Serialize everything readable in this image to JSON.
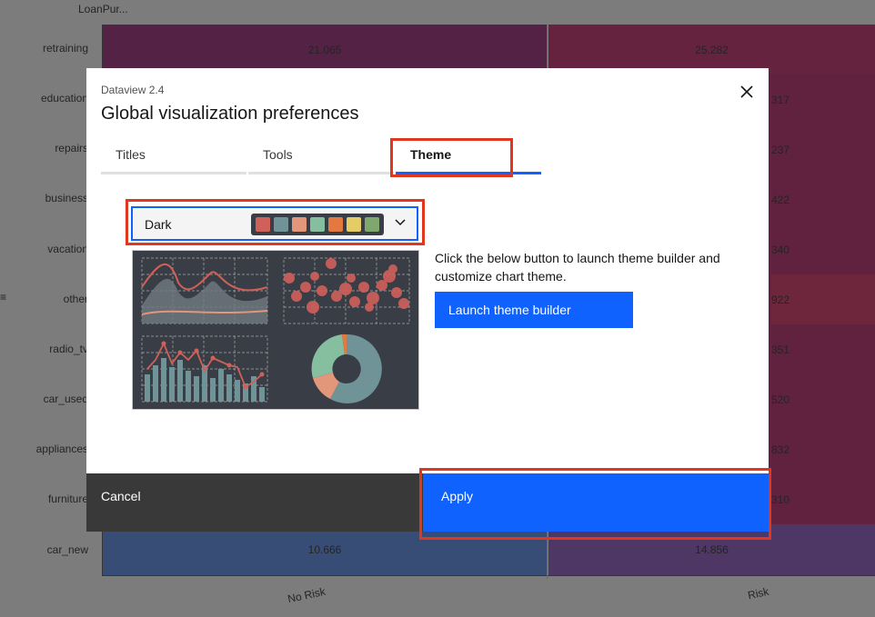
{
  "background": {
    "corner_label": "LoanPur...",
    "row_labels": [
      "retraining",
      "education",
      "repairs",
      "business",
      "vacation",
      "other",
      "radio_tv",
      "car_used",
      "appliances",
      "furniture",
      "car_new"
    ],
    "no_risk_values": [
      "21.065",
      "",
      "",
      "",
      "",
      "",
      "",
      "",
      "",
      "",
      "10.666"
    ],
    "risk_values": [
      "25.282",
      "317",
      "237",
      "422",
      "340",
      "922",
      "351",
      "520",
      "832",
      "310",
      "14.856"
    ],
    "x_labels": [
      "No Risk",
      "Risk"
    ],
    "side_mark": "≡"
  },
  "modal": {
    "label": "Dataview 2.4",
    "title": "Global visualization preferences",
    "tabs": [
      "Titles",
      "Tools",
      "Theme"
    ],
    "active_tab": "Theme",
    "theme_select": {
      "value": "Dark",
      "swatches": [
        "#d0605a",
        "#6f9397",
        "#e2967a",
        "#86bfa0",
        "#e57840",
        "#e5cc66",
        "#7fa86e"
      ]
    },
    "description": "Click the below button to launch theme builder and customize chart theme.",
    "launch_button": "Launch theme builder",
    "cancel_button": "Cancel",
    "apply_button": "Apply"
  },
  "colors": {
    "primary": "#0f62fe",
    "highlight": "#e2371f",
    "preview_bg": "#393e46"
  }
}
